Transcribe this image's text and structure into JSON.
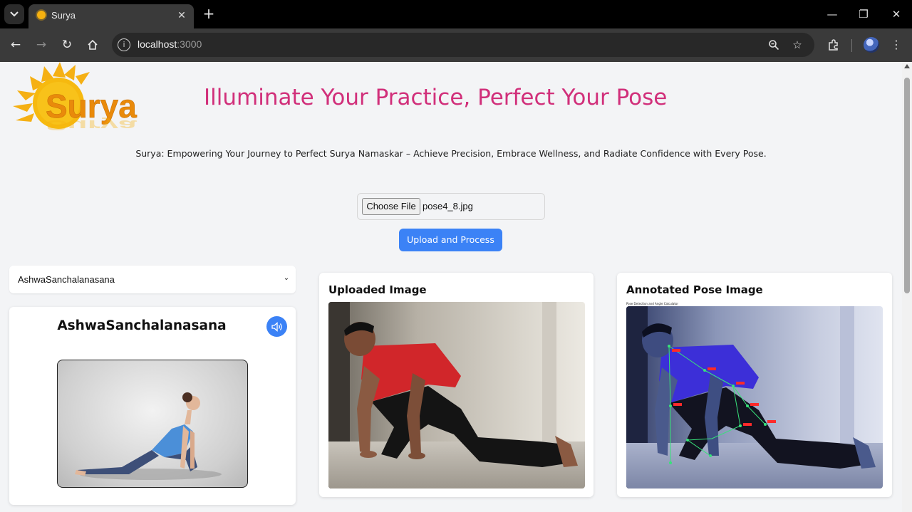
{
  "browser": {
    "tab_title": "Surya",
    "url_host": "localhost",
    "url_port": ":3000"
  },
  "page": {
    "logo_text": "Surya",
    "headline": "Illuminate Your Practice, Perfect Your Pose",
    "tagline": "Surya: Empowering Your Journey to Perfect Surya Namaskar – Achieve Precision, Embrace Wellness, and Radiate Confidence with Every Pose.",
    "file_input": {
      "button_label": "Choose File",
      "file_name": "pose4_8.jpg"
    },
    "upload_button": "Upload and Process",
    "pose_select": {
      "selected": "AshwaSanchalanasana"
    },
    "reference_card": {
      "title": "AshwaSanchalanasana"
    },
    "uploaded_card": {
      "title": "Uploaded Image"
    },
    "annotated_card": {
      "title": "Annotated Pose Image",
      "caption": "Pose Detection and Angle Calculator"
    }
  },
  "colors": {
    "headline": "#d12f7a",
    "accent_blue": "#3b82f6",
    "page_bg": "#f3f4f6"
  }
}
